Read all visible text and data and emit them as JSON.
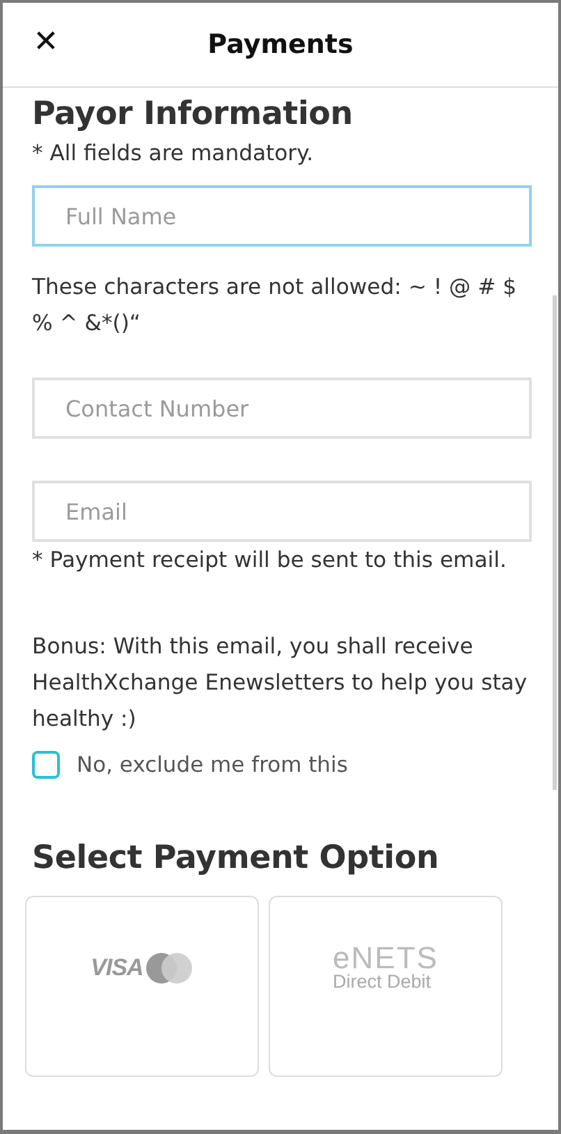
{
  "header": {
    "close_icon": "✕",
    "title": "Payments"
  },
  "payor": {
    "heading": "Payor Information",
    "note": "* All fields are mandatory.",
    "fields": [
      {
        "placeholder": "Full Name",
        "focused": true,
        "help_after": "These characters are not allowed: ~ ! @ # $ % ^ &*()“"
      },
      {
        "placeholder": "Contact Number",
        "focused": false
      },
      {
        "placeholder": "Email",
        "focused": false,
        "hint_below": "* Payment receipt will be sent to this email."
      }
    ],
    "bonus": "Bonus: With this email, you shall receive HealthXchange Enewsletters to help you stay healthy :)",
    "opt_out": {
      "label": "No, exclude me from this",
      "checked": false
    }
  },
  "payment": {
    "heading": "Select Payment Option",
    "options": [
      {
        "kind": "card",
        "logo_text": "VISA"
      },
      {
        "kind": "enets",
        "logo_text": "eNETS",
        "logo_subtext": "Direct Debit"
      }
    ]
  }
}
